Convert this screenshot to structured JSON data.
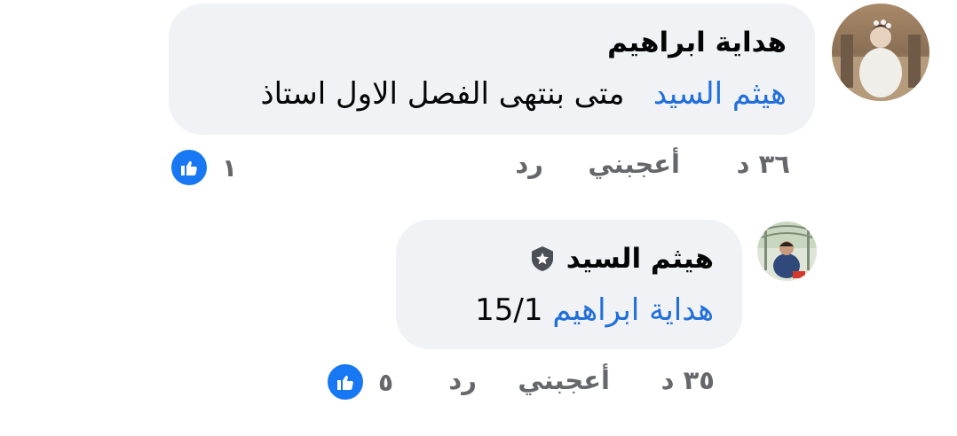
{
  "comments": [
    {
      "author": "هداية ابراهيم",
      "mention": "هيثم السيد",
      "text": "متى بنتهى الفصل الاول استاذ",
      "time": "٣٦ د",
      "like_label": "أعجبني",
      "reply_label": "رد",
      "reaction_count": "١",
      "reaction_icon": "thumbs-up-icon",
      "accent": "#1877f2"
    },
    {
      "author": "هيثم السيد",
      "author_badge_icon": "star-badge-icon",
      "mention": "هداية ابراهيم",
      "text": "15/1",
      "time": "٣٥ د",
      "like_label": "أعجبني",
      "reply_label": "رد",
      "reaction_count": "٥",
      "reaction_icon": "thumbs-up-icon",
      "accent": "#1877f2"
    }
  ],
  "colors": {
    "bubble_bg": "#f0f2f5",
    "mention": "#216fdb",
    "secondary_text": "#65676b",
    "primary_text": "#050505"
  }
}
